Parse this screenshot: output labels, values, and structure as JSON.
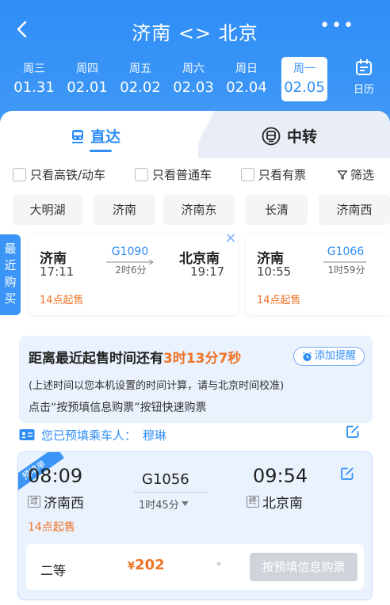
{
  "header": {
    "title": "济南 <> 北京",
    "more": "•••"
  },
  "dates": [
    {
      "weekday": "周三",
      "date": "01.31",
      "active": false
    },
    {
      "weekday": "周四",
      "date": "02.01",
      "active": false
    },
    {
      "weekday": "周五",
      "date": "02.02",
      "active": false
    },
    {
      "weekday": "周六",
      "date": "02.03",
      "active": false
    },
    {
      "weekday": "周日",
      "date": "02.04",
      "active": false
    },
    {
      "weekday": "周一",
      "date": "02.05",
      "active": true
    }
  ],
  "calendar_label": "日历",
  "tabs": {
    "direct": "直达",
    "transfer": "中转"
  },
  "filters": {
    "high_speed": "只看高铁/动车",
    "normal": "只看普通车",
    "available": "只看有票",
    "screen": "筛选"
  },
  "stations": [
    "大明湖",
    "济南",
    "济南东",
    "长清",
    "济南西"
  ],
  "recent": {
    "tag": "最近购买",
    "cards": [
      {
        "from": "济南",
        "from_time": "17:11",
        "train": "G1090",
        "duration": "2时6分",
        "to": "北京南",
        "to_time": "19:17",
        "sale": "14点起售"
      },
      {
        "from": "济南",
        "from_time": "10:55",
        "train": "G1066",
        "duration": "1时59分",
        "sale": "14点起售"
      }
    ]
  },
  "presale": {
    "countdown_prefix": "距离最近起售时间还有",
    "countdown": "3时13分7秒",
    "remind_label": "添加提醒",
    "note": "(上述时间以您本机设置的时间计算，请与北京时间校准)",
    "hint": "点击“按预填信息购票”按钮快速购票",
    "passenger_label": "您已预填乘车人：",
    "passenger_name": "穆琳"
  },
  "order": {
    "ribbon": "预填单",
    "dep_time": "08:09",
    "from_tag": "过",
    "from": "济南西",
    "train": "G1056",
    "duration": "1时45分",
    "arr_time": "09:54",
    "to_tag": "终",
    "to": "北京南",
    "sale": "14点起售",
    "seat_type": "二等",
    "currency": "¥",
    "price": "202",
    "star": "*",
    "buy_label": "按预填信息购票"
  },
  "colors": {
    "primary": "#2f8ef7",
    "accent": "#f07324",
    "disabled": "#cfd4da"
  }
}
